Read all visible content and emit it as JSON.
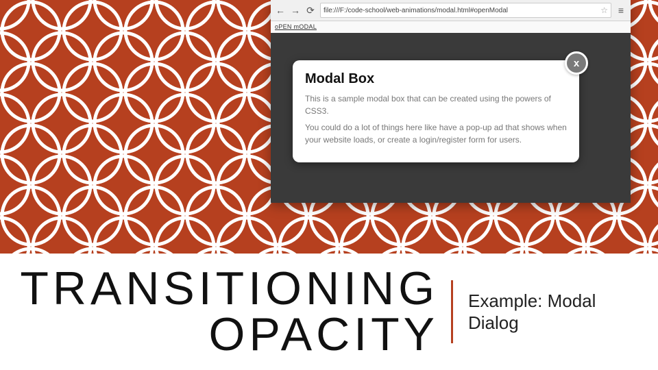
{
  "browser": {
    "url": "file:///F:/code-school/web-animations/modal.html#openModal",
    "tab_label": "oPEN mODAL"
  },
  "modal": {
    "heading": "Modal Box",
    "paragraph1": "This is a sample modal box that can be created using the powers of CSS3.",
    "paragraph2": "You could do a lot of things here like have a pop-up ad that shows when your website loads, or create a login/register form for users.",
    "close_glyph": "x"
  },
  "slide": {
    "title_line1": "TRANSITIONING",
    "title_line2": "OPACITY",
    "subtitle_line1": "Example: Modal",
    "subtitle_line2": "Dialog"
  },
  "icons": {
    "back": "←",
    "forward": "→",
    "reload": "⟳",
    "star": "☆",
    "menu": "≡"
  }
}
